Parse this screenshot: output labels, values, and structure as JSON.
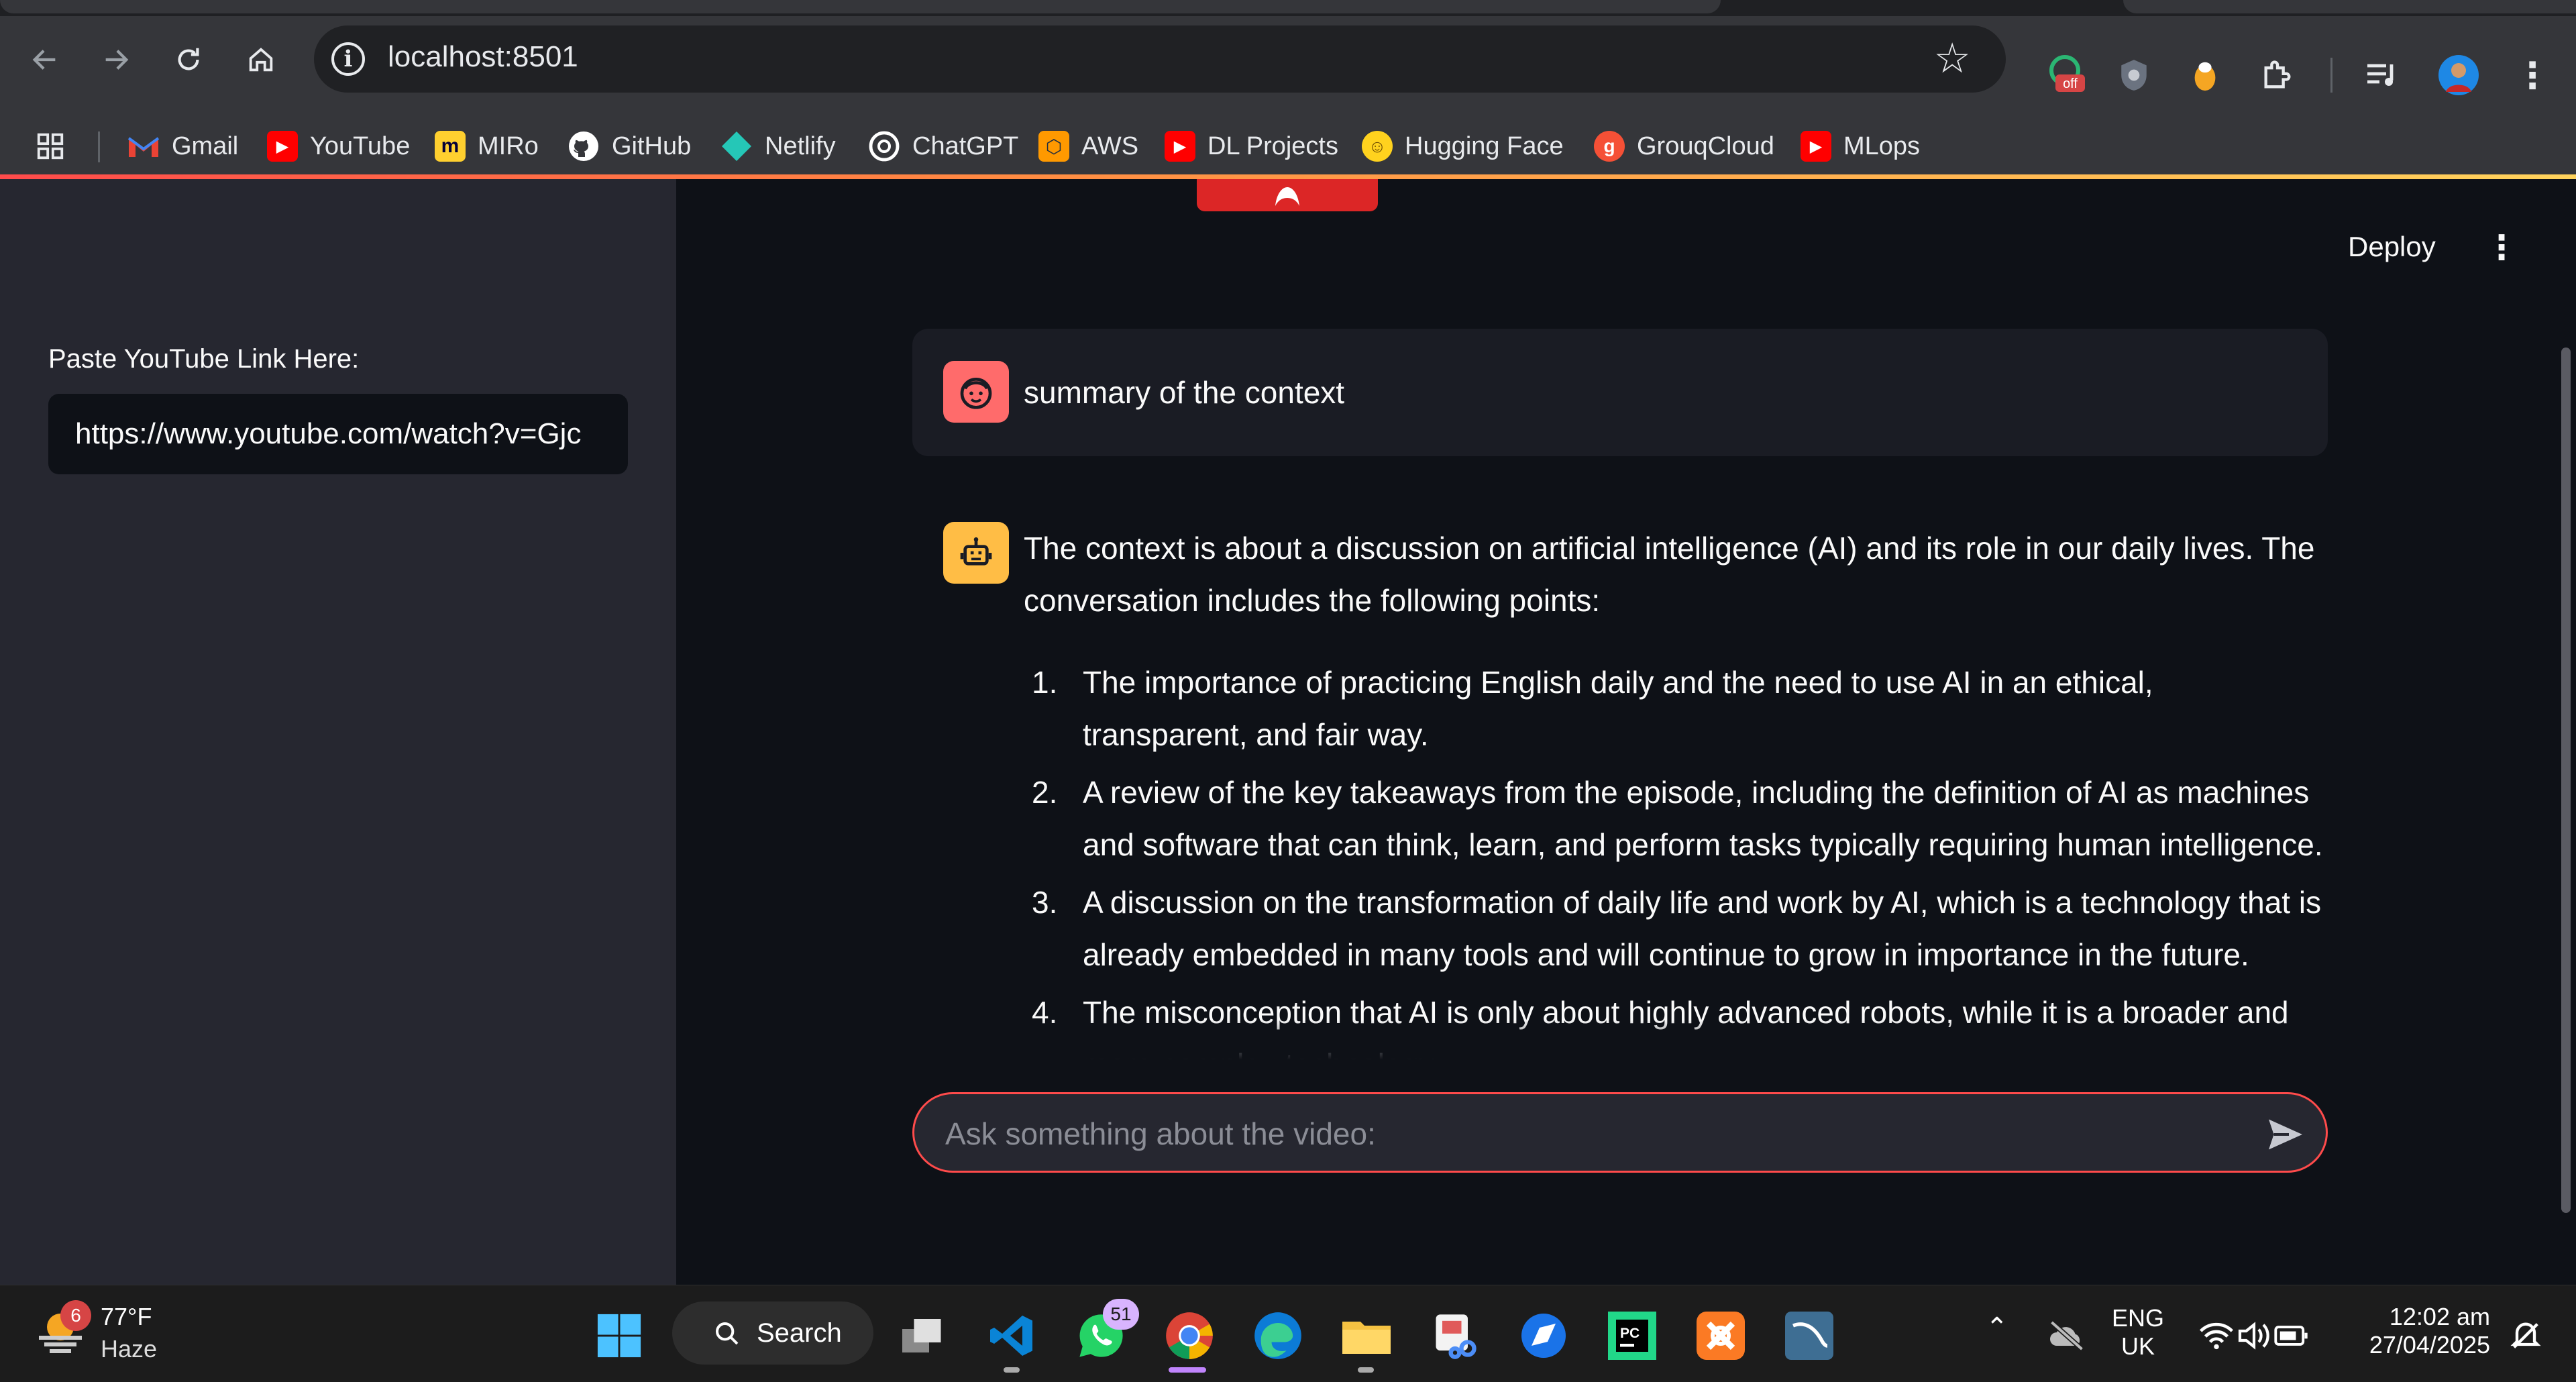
{
  "browser": {
    "url": "localhost:8501",
    "bookmarks": [
      {
        "label": "Gmail",
        "icon": "gmail-icon",
        "color": "#ea4335"
      },
      {
        "label": "YouTube",
        "icon": "youtube-icon",
        "color": "#ff0000"
      },
      {
        "label": "MIRo",
        "icon": "miro-icon",
        "color": "#ffd02f"
      },
      {
        "label": "GitHub",
        "icon": "github-icon",
        "color": "#ffffff"
      },
      {
        "label": "Netlify",
        "icon": "netlify-icon",
        "color": "#25c7b7"
      },
      {
        "label": "ChatGPT",
        "icon": "chatgpt-icon",
        "color": "#ffffff"
      },
      {
        "label": "AWS",
        "icon": "aws-icon",
        "color": "#f90"
      },
      {
        "label": "DL Projects",
        "icon": "youtube-icon",
        "color": "#ff0000"
      },
      {
        "label": "Hugging Face",
        "icon": "hugging-face-icon",
        "color": "#ffd21e"
      },
      {
        "label": "GrouqCloud",
        "icon": "groq-icon",
        "color": "#f55036"
      },
      {
        "label": "MLops",
        "icon": "youtube-icon",
        "color": "#ff0000"
      }
    ],
    "extension_badge": "off"
  },
  "app": {
    "deploy_label": "Deploy",
    "sidebar": {
      "label": "Paste YouTube Link Here:",
      "input_value": "https://www.youtube.com/watch?v=Gjc"
    },
    "chat": {
      "user_message": "summary of the context",
      "bot_intro": "The context is about a discussion on artificial intelligence (AI) and its role in our daily lives. The conversation includes the following points:",
      "bot_points": [
        {
          "num": "1.",
          "text": "The importance of practicing English daily and the need to use AI in an ethical, transparent, and fair way."
        },
        {
          "num": "2.",
          "text": "A review of the key takeaways from the episode, including the definition of AI as machines and software that can think, learn, and perform tasks typically requiring human intelligence."
        },
        {
          "num": "3.",
          "text": "A discussion on the transformation of daily life and work by AI, which is a technology that is already embedded in many tools and will continue to grow in importance in the future."
        },
        {
          "num": "4.",
          "text": "The misconception that AI is only about highly advanced robots, while it is a broader and more complex technology."
        }
      ],
      "input_placeholder": "Ask something about the video:"
    },
    "accent_color": "#ff4b4b"
  },
  "taskbar": {
    "weather_temp": "77°F",
    "weather_cond": "Haze",
    "weather_badge": "6",
    "search_label": "Search",
    "whatsapp_badge": "51",
    "lang_top": "ENG",
    "lang_bottom": "UK",
    "time": "12:02 am",
    "date": "27/04/2025"
  }
}
